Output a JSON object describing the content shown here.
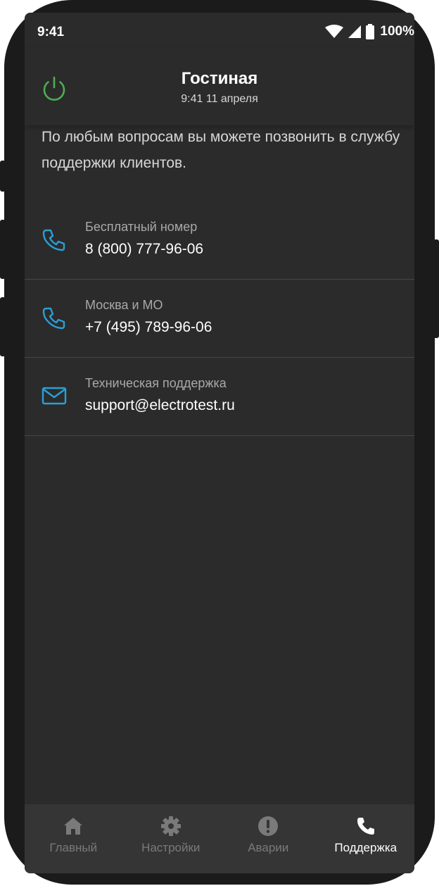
{
  "status_bar": {
    "time": "9:41",
    "battery": "100%"
  },
  "header": {
    "title": "Гостиная",
    "subtitle": "9:41 11 апреля"
  },
  "intro_text": "По любым вопросам вы можете позвонить в службу поддержки клиентов.",
  "contacts": [
    {
      "icon": "phone-icon",
      "label": "Бесплатный номер",
      "value": "8 (800) 777-96-06"
    },
    {
      "icon": "phone-icon",
      "label": "Москва и МО",
      "value": "+7 (495) 789-96-06"
    },
    {
      "icon": "mail-icon",
      "label": "Техническая поддержка",
      "value": "support@electrotest.ru"
    }
  ],
  "bottom_nav": [
    {
      "icon": "home-icon",
      "label": "Главный",
      "active": false
    },
    {
      "icon": "gear-icon",
      "label": "Настройки",
      "active": false
    },
    {
      "icon": "alert-icon",
      "label": "Аварии",
      "active": false
    },
    {
      "icon": "phone-icon",
      "label": "Поддержка",
      "active": true
    }
  ],
  "colors": {
    "accent_blue": "#2a9fd6",
    "power_green": "#4caf50",
    "background": "#2b2b2b"
  }
}
